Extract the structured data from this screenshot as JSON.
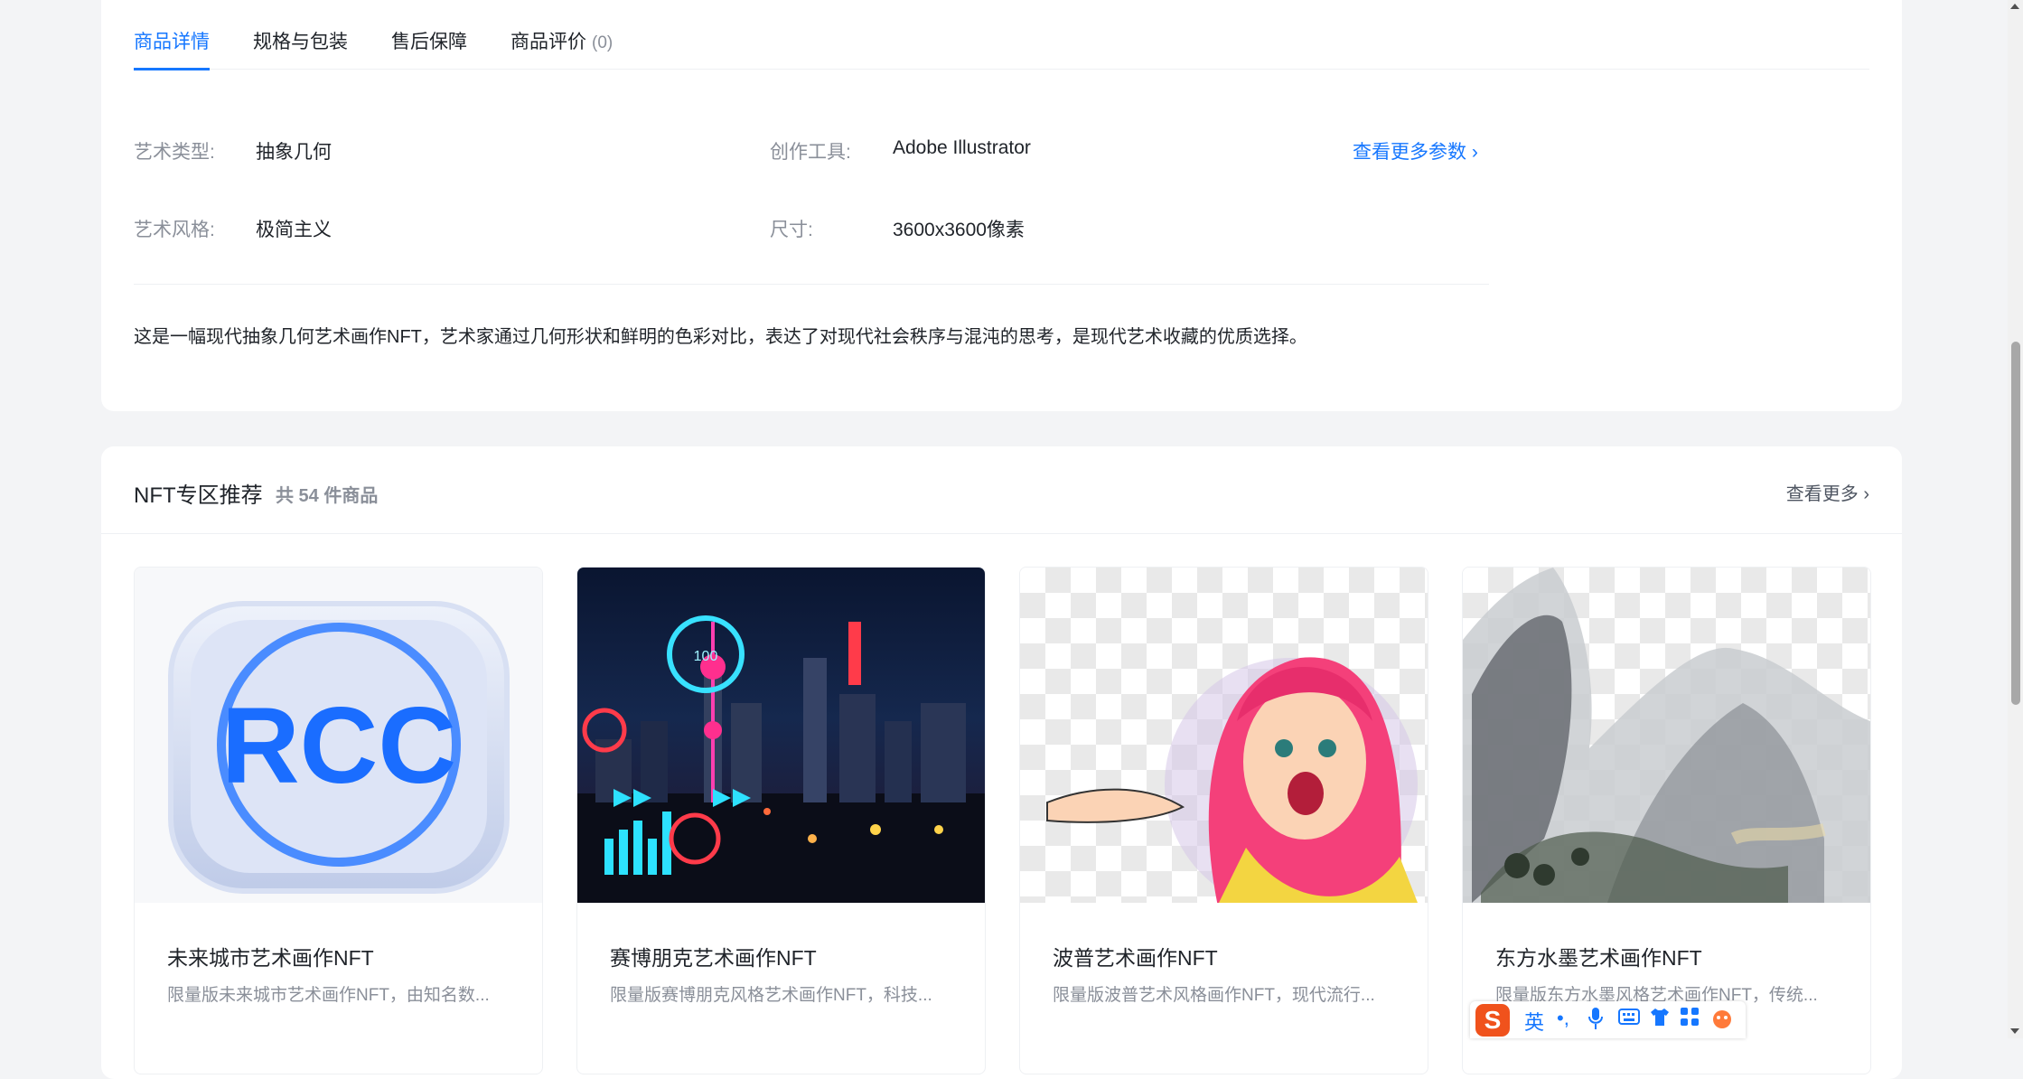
{
  "tabs": [
    {
      "label": "商品详情"
    },
    {
      "label": "规格与包装"
    },
    {
      "label": "售后保障"
    },
    {
      "label": "商品评价",
      "count": "(0)"
    }
  ],
  "params": {
    "art_type_label": "艺术类型:",
    "art_type_value": "抽象几何",
    "tool_label": "创作工具:",
    "tool_value": "Adobe Illustrator",
    "style_label": "艺术风格:",
    "style_value": "极简主义",
    "size_label": "尺寸:",
    "size_value": "3600x3600像素",
    "more_label": "查看更多参数 ›"
  },
  "description": "这是一幅现代抽象几何艺术画作NFT，艺术家通过几何形状和鲜明的色彩对比，表达了对现代社会秩序与混沌的思考，是现代艺术收藏的优质选择。",
  "recommend": {
    "title": "NFT专区推荐",
    "count": "共 54 件商品",
    "more": "查看更多  ›",
    "products": [
      {
        "name": "未来城市艺术画作NFT",
        "desc": "限量版未来城市艺术画作NFT，由知名数...",
        "logo_text": "RCC"
      },
      {
        "name": "赛博朋克艺术画作NFT",
        "desc": "限量版赛博朋克风格艺术画作NFT，科技...",
        "hud_text": "100"
      },
      {
        "name": "波普艺术画作NFT",
        "desc": "限量版波普艺术风格画作NFT，现代流行..."
      },
      {
        "name": "东方水墨艺术画作NFT",
        "desc": "限量版东方水墨风格艺术画作NFT，传统..."
      }
    ]
  },
  "ime": {
    "logo": "S",
    "lang": "英",
    "punct": "•,"
  },
  "colors": {
    "accent": "#1677ff",
    "muted": "#8a8f99",
    "background": "#f3f4f6"
  }
}
